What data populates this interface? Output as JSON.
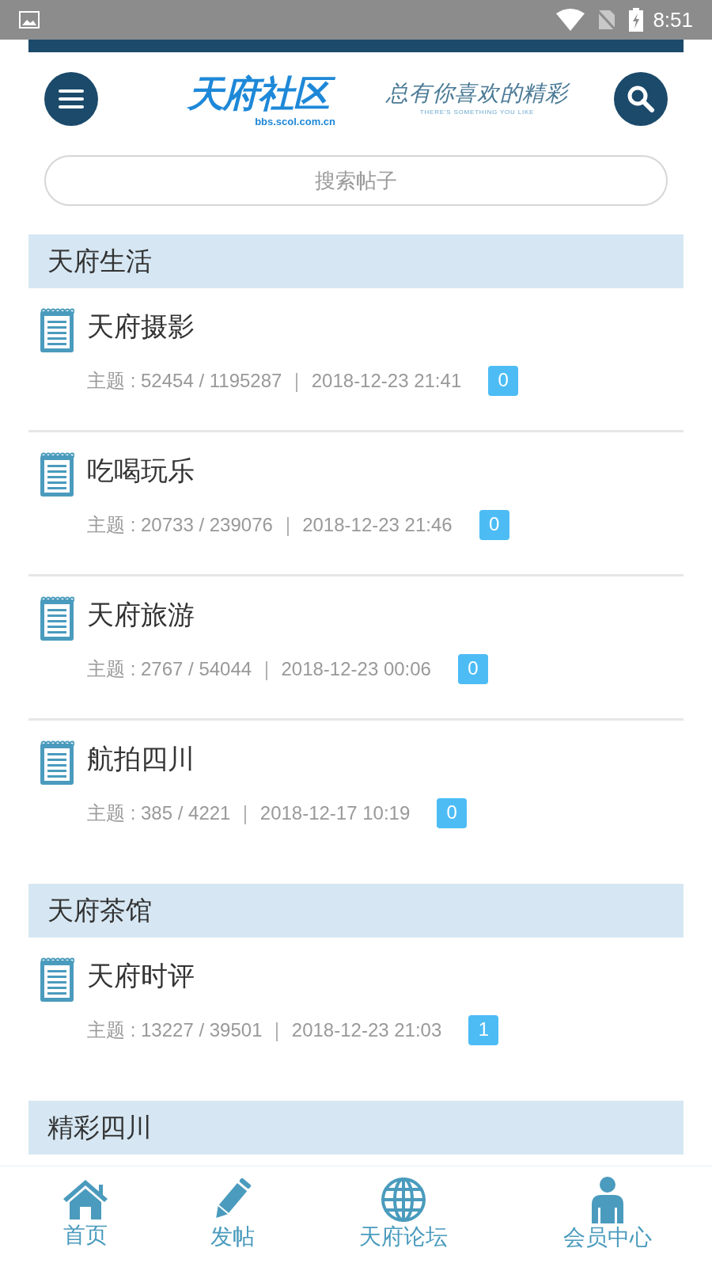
{
  "status_bar": {
    "time": "8:51"
  },
  "header": {
    "logo": "天府社区",
    "logo_url": "bbs.scol.com.cn",
    "slogan": "总有你喜欢的精彩",
    "slogan_en": "THERE'S SOMETHING YOU LIKE"
  },
  "search": {
    "placeholder": "搜索帖子"
  },
  "sections": [
    {
      "title": "天府生活",
      "forums": [
        {
          "name": "天府摄影",
          "stats": "主题 : 52454 / 1195287 ｜ 2018-12-23 21:41",
          "badge": "0"
        },
        {
          "name": "吃喝玩乐",
          "stats": "主题 : 20733 / 239076 ｜ 2018-12-23 21:46",
          "badge": "0"
        },
        {
          "name": "天府旅游",
          "stats": "主题 : 2767 / 54044 ｜ 2018-12-23 00:06",
          "badge": "0"
        },
        {
          "name": "航拍四川",
          "stats": "主题 : 385 / 4221 ｜ 2018-12-17 10:19",
          "badge": "0"
        }
      ]
    },
    {
      "title": "天府茶馆",
      "forums": [
        {
          "name": "天府时评",
          "stats": "主题 : 13227 / 39501 ｜ 2018-12-23 21:03",
          "badge": "1"
        }
      ]
    },
    {
      "title": "精彩四川"
    }
  ],
  "bottom_nav": [
    {
      "kind": "home",
      "label": "首页"
    },
    {
      "kind": "post",
      "label": "发帖"
    },
    {
      "kind": "forum",
      "label": "天府论坛"
    },
    {
      "kind": "member",
      "label": "会员中心"
    }
  ]
}
